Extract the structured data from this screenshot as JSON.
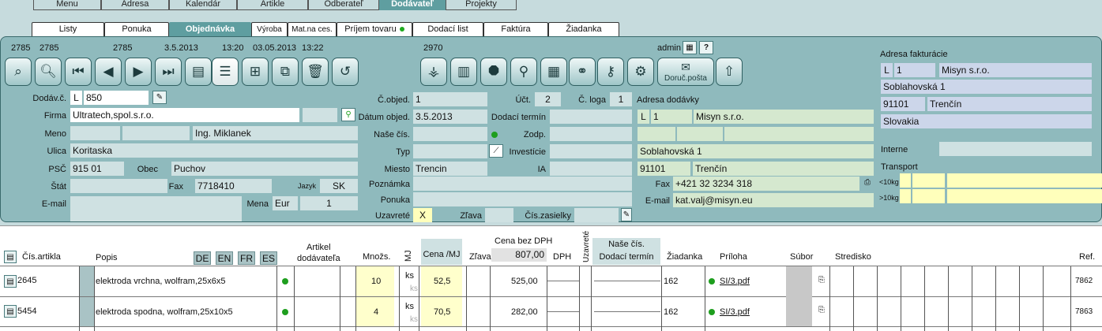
{
  "topnav": [
    "Menu",
    "Adresa",
    "Kalendár",
    "Artikle",
    "Odberateľ",
    "Dodávateľ",
    "Projekty"
  ],
  "subnav": [
    "Listy",
    "Ponuka",
    "Objednávka",
    "Výroba",
    "Mat.na ces.",
    "Príjem tovaru",
    "Dodací list",
    "Faktúra",
    "Žiadanka"
  ],
  "header": {
    "n1": "2785",
    "n2": "2785",
    "n3": "2785",
    "d1": "3.5.2013",
    "t1": "13:20",
    "d2": "03.05.2013",
    "t2": "13:22",
    "n4": "2970",
    "user": "admin",
    "doruc": "Doruč.pošta"
  },
  "icons": [
    "search-doc-icon",
    "magnifier-icon",
    "first-icon",
    "prev-icon",
    "next-icon",
    "last-icon",
    "new-doc-icon",
    "list-doc-icon",
    "add-doc-icon",
    "copy-doc-icon",
    "trash-icon",
    "undo-icon"
  ],
  "icons2": [
    "tree-icon",
    "docs-icon",
    "stop-icon",
    "find-icon",
    "add-list-icon",
    "link-icon",
    "key-icon",
    "gear-icon"
  ],
  "left": {
    "dodavc_label": "Dodáv.č.",
    "dodavc_type": "L",
    "dodavc_value": "850",
    "firma_label": "Firma",
    "firma": "Ultratech,spol.s.r.o.",
    "meno_label": "Meno",
    "meno": "Ing. Miklanek",
    "ulica_label": "Ulica",
    "ulica": "Koritaska",
    "psc_label": "PSČ",
    "psc": "915 01",
    "obec_label": "Obec",
    "obec": "Puchov",
    "stat_label": "Štát",
    "fax_label": "Fax",
    "fax": "7718410",
    "jazyk_label": "Jazyk",
    "jazyk": "SK",
    "email_label": "E-mail",
    "mena_label": "Mena",
    "mena": "Eur",
    "mena_rate": "1"
  },
  "mid": {
    "cobjed_label": "Č.objed.",
    "cobjed": "1",
    "uct_label": "Účt.",
    "uct": "2",
    "cloga_label": "Č. loga",
    "cloga": "1",
    "datum_label": "Dátum objed.",
    "datum": "3.5.2013",
    "dodterm_label": "Dodací termín",
    "nasecis_label": "Naše čís.",
    "zodp_label": "Zodp.",
    "typ_label": "Typ",
    "invest_label": "Investície",
    "miesto_label": "Miesto",
    "miesto": "Trencin",
    "ia_label": "IA",
    "pozn_label": "Poznámka",
    "ponuka_label": "Ponuka",
    "uzav_label": "Uzavreté",
    "uzav": "X",
    "zlava_label": "Zľava",
    "ciszas_label": "Čís.zasielky"
  },
  "dodavky": {
    "title": "Adresa dodávky",
    "type": "L",
    "num": "1",
    "name": "Misyn s.r.o.",
    "street": "Soblahovská 1",
    "psc": "91101",
    "city": "Trenčín",
    "fax_label": "Fax",
    "fax": "+421 32 3234 318",
    "email_label": "E-mail",
    "email": "kat.valj@misyn.eu"
  },
  "fakturacie": {
    "title": "Adresa fakturácie",
    "type": "L",
    "num": "1",
    "name": "Misyn s.r.o.",
    "street": "Soblahovská 1",
    "psc": "91101",
    "city": "Trenčín",
    "country": "Slovakia",
    "interne_label": "Interne",
    "transport_label": "Transport",
    "t1": "<10kg",
    "t2": ">10kg"
  },
  "grid": {
    "headers": {
      "cis": "Čís.artikla",
      "popis": "Popis",
      "artikel": "Artikel",
      "dodavatela": "dodávateľa",
      "mnozs": "Množs.",
      "mj": "MJ",
      "cena_mj": "Cena /MJ",
      "zlava": "Zľava",
      "cena_bez": "Cena bez DPH",
      "cena_total": "807,00",
      "dph": "DPH",
      "uzavrete": "Uzavreté",
      "nase_cis": "Naše čís.",
      "dod_term": "Dodací termín",
      "ziadanka": "Žiadanka",
      "priloha": "Príloha",
      "subor": "Súbor",
      "stredisko": "Stredisko",
      "ref": "Ref."
    },
    "langs": [
      "DE",
      "EN",
      "FR",
      "ES"
    ],
    "rows": [
      {
        "cis": "2645",
        "popis": "elektroda vrchna, wolfram,25x6x5",
        "mnozs": "10",
        "mj1": "ks",
        "mj2": "ks",
        "cena": "52,5",
        "total": "525,00",
        "ziadanka": "162",
        "priloha": "SI/3.pdf",
        "ref": "7862"
      },
      {
        "cis": "5454",
        "popis": "elektroda spodna, wolfram,25x10x5",
        "mnozs": "4",
        "mj1": "ks",
        "mj2": "ks",
        "cena": "70,5",
        "total": "282,00",
        "ziadanka": "162",
        "priloha": "SI/3.pdf",
        "ref": "7863"
      }
    ]
  }
}
